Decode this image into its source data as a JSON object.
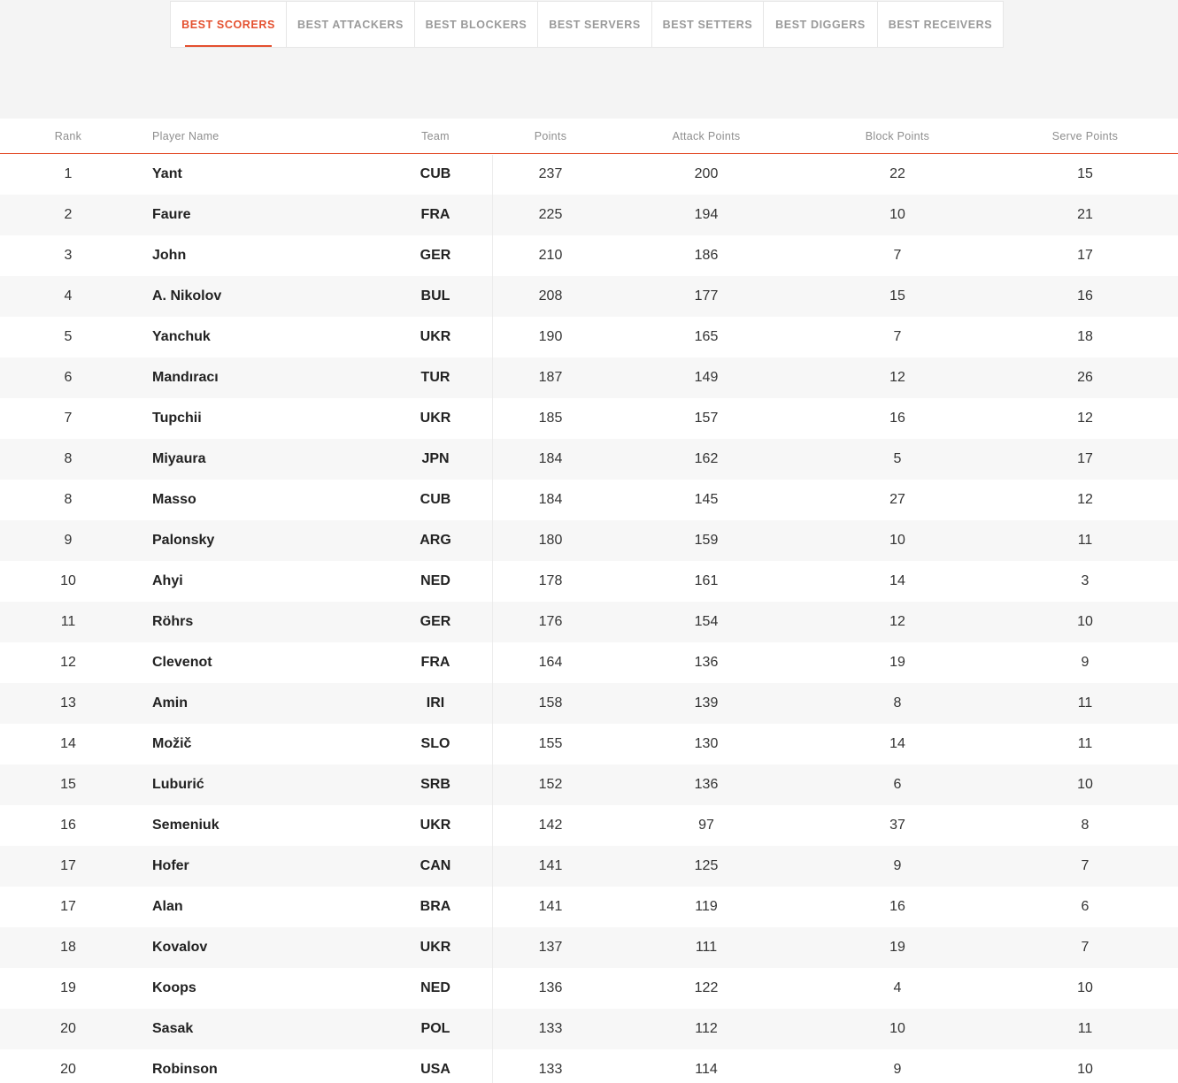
{
  "tabs": [
    {
      "label": "BEST SCORERS",
      "active": true
    },
    {
      "label": "BEST ATTACKERS",
      "active": false
    },
    {
      "label": "BEST BLOCKERS",
      "active": false
    },
    {
      "label": "BEST SERVERS",
      "active": false
    },
    {
      "label": "BEST SETTERS",
      "active": false
    },
    {
      "label": "BEST DIGGERS",
      "active": false
    },
    {
      "label": "BEST RECEIVERS",
      "active": false
    }
  ],
  "table": {
    "headers": {
      "rank": "Rank",
      "name": "Player Name",
      "team": "Team",
      "points": "Points",
      "attack": "Attack Points",
      "block": "Block Points",
      "serve": "Serve Points"
    },
    "rows": [
      {
        "rank": "1",
        "name": "Yant",
        "team": "CUB",
        "points": "237",
        "attack": "200",
        "block": "22",
        "serve": "15"
      },
      {
        "rank": "2",
        "name": "Faure",
        "team": "FRA",
        "points": "225",
        "attack": "194",
        "block": "10",
        "serve": "21"
      },
      {
        "rank": "3",
        "name": "John",
        "team": "GER",
        "points": "210",
        "attack": "186",
        "block": "7",
        "serve": "17"
      },
      {
        "rank": "4",
        "name": "A. Nikolov",
        "team": "BUL",
        "points": "208",
        "attack": "177",
        "block": "15",
        "serve": "16"
      },
      {
        "rank": "5",
        "name": "Yanchuk",
        "team": "UKR",
        "points": "190",
        "attack": "165",
        "block": "7",
        "serve": "18"
      },
      {
        "rank": "6",
        "name": "Mandıracı",
        "team": "TUR",
        "points": "187",
        "attack": "149",
        "block": "12",
        "serve": "26"
      },
      {
        "rank": "7",
        "name": "Tupchii",
        "team": "UKR",
        "points": "185",
        "attack": "157",
        "block": "16",
        "serve": "12"
      },
      {
        "rank": "8",
        "name": "Miyaura",
        "team": "JPN",
        "points": "184",
        "attack": "162",
        "block": "5",
        "serve": "17"
      },
      {
        "rank": "8",
        "name": "Masso",
        "team": "CUB",
        "points": "184",
        "attack": "145",
        "block": "27",
        "serve": "12"
      },
      {
        "rank": "9",
        "name": "Palonsky",
        "team": "ARG",
        "points": "180",
        "attack": "159",
        "block": "10",
        "serve": "11"
      },
      {
        "rank": "10",
        "name": "Ahyi",
        "team": "NED",
        "points": "178",
        "attack": "161",
        "block": "14",
        "serve": "3"
      },
      {
        "rank": "11",
        "name": "Röhrs",
        "team": "GER",
        "points": "176",
        "attack": "154",
        "block": "12",
        "serve": "10"
      },
      {
        "rank": "12",
        "name": "Clevenot",
        "team": "FRA",
        "points": "164",
        "attack": "136",
        "block": "19",
        "serve": "9"
      },
      {
        "rank": "13",
        "name": "Amin",
        "team": "IRI",
        "points": "158",
        "attack": "139",
        "block": "8",
        "serve": "11"
      },
      {
        "rank": "14",
        "name": "Možič",
        "team": "SLO",
        "points": "155",
        "attack": "130",
        "block": "14",
        "serve": "11"
      },
      {
        "rank": "15",
        "name": "Luburić",
        "team": "SRB",
        "points": "152",
        "attack": "136",
        "block": "6",
        "serve": "10"
      },
      {
        "rank": "16",
        "name": "Semeniuk",
        "team": "UKR",
        "points": "142",
        "attack": "97",
        "block": "37",
        "serve": "8"
      },
      {
        "rank": "17",
        "name": "Hofer",
        "team": "CAN",
        "points": "141",
        "attack": "125",
        "block": "9",
        "serve": "7"
      },
      {
        "rank": "17",
        "name": "Alan",
        "team": "BRA",
        "points": "141",
        "attack": "119",
        "block": "16",
        "serve": "6"
      },
      {
        "rank": "18",
        "name": "Kovalov",
        "team": "UKR",
        "points": "137",
        "attack": "111",
        "block": "19",
        "serve": "7"
      },
      {
        "rank": "19",
        "name": "Koops",
        "team": "NED",
        "points": "136",
        "attack": "122",
        "block": "4",
        "serve": "10"
      },
      {
        "rank": "20",
        "name": "Sasak",
        "team": "POL",
        "points": "133",
        "attack": "112",
        "block": "10",
        "serve": "11"
      },
      {
        "rank": "20",
        "name": "Robinson",
        "team": "USA",
        "points": "133",
        "attack": "114",
        "block": "9",
        "serve": "10"
      }
    ]
  },
  "colors": {
    "accent": "#e4502f",
    "page_background": "#f4f4f4",
    "row_alt": "#f7f7f7"
  }
}
